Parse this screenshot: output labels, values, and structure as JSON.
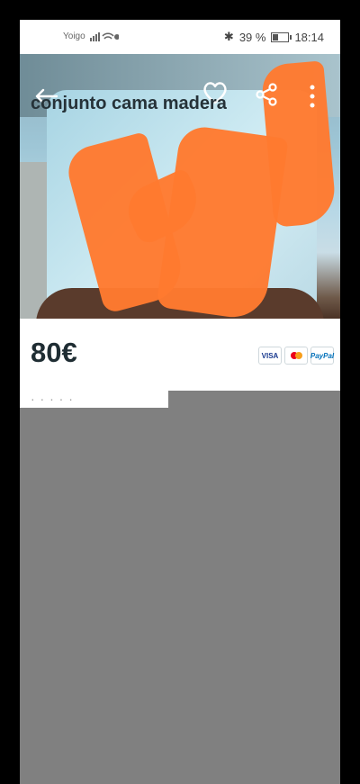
{
  "status_bar": {
    "carrier": "Yoigo",
    "battery_percent": "39 %",
    "time": "18:14"
  },
  "listing": {
    "price": "80€",
    "title": "conjunto cama madera",
    "description_fragment": "· · · · ·"
  },
  "payment_methods": [
    "VISA",
    "Mastercard",
    "PayPal"
  ],
  "icons": [
    "back-arrow-icon",
    "heart-icon",
    "share-icon",
    "more-vertical-icon",
    "wifi-icon",
    "signal-icon",
    "bluetooth-icon",
    "battery-icon"
  ],
  "colors": {
    "scribble": "#ff7a2f",
    "price_text": "#1f2d33",
    "overlay_gray": "#808080"
  }
}
